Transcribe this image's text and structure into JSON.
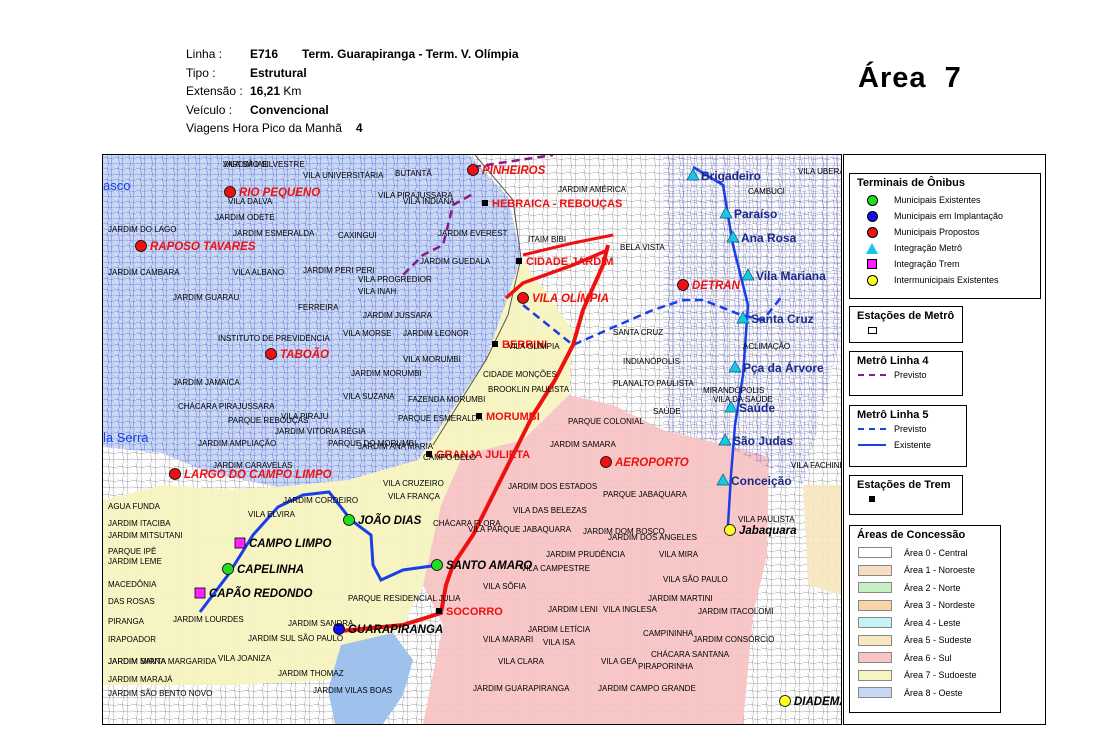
{
  "route_info": {
    "line_label": "Linha :",
    "line_code": "E716",
    "line_name": "Term. Guarapiranga - Term. V. Olímpia",
    "type_label": "Tipo :",
    "type_value": "Estrutural",
    "length_label": "Extensão :",
    "length_value": "16,21",
    "length_unit": "Km",
    "vehicle_label": "Veículo :",
    "vehicle_value": "Convencional",
    "trips_label": "Viagens Hora Pico da Manhã",
    "trips_value": "4"
  },
  "area_title": "Área  7",
  "legend": {
    "terminals": {
      "title": "Terminais de Ônibus",
      "items": [
        {
          "label": "Municipais Existentes",
          "color": "#22dd22",
          "shape": "circle"
        },
        {
          "label": "Municipais em Implantação",
          "color": "#1010e6",
          "shape": "circle"
        },
        {
          "label": "Municipais Propostos",
          "color": "#ee1111",
          "shape": "circle"
        },
        {
          "label": "Integração Metrô",
          "color": "#19c6e8",
          "shape": "triangle"
        },
        {
          "label": "Integração Trem",
          "color": "#ff22ff",
          "shape": "square"
        },
        {
          "label": "Intermunicipais Existentes",
          "color": "#ffff22",
          "shape": "circle"
        }
      ]
    },
    "metro_stations": {
      "title": "Estações de Metrô"
    },
    "metro_line4": {
      "title": "Metrô Linha 4",
      "items": [
        {
          "label": "Previsto",
          "color": "#8a1a8a",
          "style": "dashed"
        }
      ]
    },
    "metro_line5": {
      "title": "Metrô Linha 5",
      "items": [
        {
          "label": "Previsto",
          "color": "#1a3ee8",
          "style": "dashed"
        },
        {
          "label": "Existente",
          "color": "#1a3ee8",
          "style": "solid"
        }
      ]
    },
    "train_stations": {
      "title": "Estações de Trem"
    },
    "concession": {
      "title": "Áreas de Concessão",
      "items": [
        {
          "label": "Área 0 - Central",
          "color": "#ffffff"
        },
        {
          "label": "Área 1 - Noroeste",
          "color": "#f8dcc4"
        },
        {
          "label": "Área 2 - Norte",
          "color": "#c4f0c4"
        },
        {
          "label": "Área 3 - Nordeste",
          "color": "#f8d4a8"
        },
        {
          "label": "Área 4 - Leste",
          "color": "#c4f4f4"
        },
        {
          "label": "Área 5 - Sudeste",
          "color": "#f8e8c0"
        },
        {
          "label": "Área 6 - Sul",
          "color": "#f8c4c4"
        },
        {
          "label": "Área 7 - Sudoeste",
          "color": "#f8f4c0"
        },
        {
          "label": "Área 8 - Oeste",
          "color": "#c8d8f4"
        }
      ]
    }
  },
  "map": {
    "terminals": [
      {
        "name": "PINHEIROS",
        "kind": "proposed"
      },
      {
        "name": "RIO PEQUENO",
        "kind": "proposed"
      },
      {
        "name": "RAPOSO TAVARES",
        "kind": "proposed"
      },
      {
        "name": "VILA OLÍMPIA",
        "kind": "proposed"
      },
      {
        "name": "DETRAN",
        "kind": "proposed"
      },
      {
        "name": "TABOÃO",
        "kind": "proposed"
      },
      {
        "name": "AEROPORTO",
        "kind": "proposed"
      },
      {
        "name": "LARGO DO CAMPO LIMPO",
        "kind": "proposed"
      },
      {
        "name": "JOÃO DIAS",
        "kind": "existing"
      },
      {
        "name": "CAPELINHA",
        "kind": "existing"
      },
      {
        "name": "SANTO AMARO",
        "kind": "existing"
      },
      {
        "name": "GUARAPIRANGA",
        "kind": "implementation"
      },
      {
        "name": "CAMPO LIMPO",
        "kind": "train"
      },
      {
        "name": "CAPÃO REDONDO",
        "kind": "train"
      },
      {
        "name": "Jabaquara",
        "kind": "intermunicipal"
      },
      {
        "name": "DIADEMA",
        "kind": "intermunicipal"
      }
    ],
    "metro_stations": [
      "Brigadeiro",
      "Paraíso",
      "Ana Rosa",
      "Vila Mariana",
      "Santa Cruz",
      "Pça da Árvore",
      "Saúde",
      "São Judas",
      "Conceição"
    ],
    "train_stations": [
      "HEBRAICA - REBOUÇAS",
      "CIDADE JARDIM",
      "BERRINI",
      "MORUMBI",
      "GRANJA JULIETA",
      "SOCORRO"
    ],
    "edge_labels": [
      "asco",
      "la Serra"
    ],
    "neighborhoods": [
      "VILA SÃO SILVESTRE",
      "VILA UNIVERSITÁRIA",
      "BUTANTÃ",
      "JARDIM AMÉRICA",
      "VILA INDIANA",
      "VILA DALVA",
      "VILA PIRAJUSSARA",
      "JARDIM ODETE",
      "JARDIM ESMERALDA",
      "JARDIM DO LAGO",
      "JARDIM EVEREST",
      "CAXINGUI",
      "JARDIM GUEDALA",
      "ITAIM BIBI",
      "BELA VISTA",
      "JARDIM CAMBARA",
      "VILA ALBANO",
      "JARDIM PERI PERI",
      "VILA PROGREDIOR",
      "VILA INAH",
      "JARDIM GUARAU",
      "FERREIRA",
      "JARDIM JUSSARA",
      "VILA MORSE",
      "JARDIM LEONOR",
      "INSTITUTO DE PREVIDÊNCIA",
      "VILA OLÍMPIA",
      "VILA MORUMBI",
      "JARDIM MORUMBI",
      "CIDADE MONÇÕES",
      "BROOKLIN PAULISTA",
      "JARDIM JAMAICA",
      "VILA SUZANA",
      "FAZENDA MORUMBI",
      "CHÁCARA PIRAJUSSARA",
      "VILA PIRAJU",
      "PARQUE ESMERALDA",
      "PARQUE REBOUÇAS",
      "JARDIM VITÓRIA RÉGIA",
      "JARDIM ANA MARIA",
      "JARDIM AMPLIAÇÃO",
      "PARQUE DO MORUMBI",
      "CAMPO BELO",
      "PARQUE COLONIAL",
      "JARDIM SAMARA",
      "JARDIM CARAVELAS",
      "VILA CRUZEIRO",
      "VILA FRANÇA",
      "JARDIM CORDEIRO",
      "JARDIM DOS ESTADOS",
      "PARQUE JABAQUARA",
      "VILA DAS BELEZAS",
      "VILA ELVIRA",
      "CHÁCARA FLORA",
      "VILA PARQUE JABAQUARA",
      "JARDIM DOM BOSCO",
      "JARDIM DOS ANGELES",
      "JARDIM PRUDÊNCIA",
      "VILA MIRA",
      "VILA SÃO PAULO",
      "VILA CAMPESTRE",
      "VILA SÔFIA",
      "PARQUE RESIDENCIAL JULIA",
      "JARDIM LENI",
      "VILA INGLESA",
      "JARDIM ITACOLOMI",
      "JARDIM LOURDES",
      "JARDIM SANDRA",
      "JARDIM LETÍCIA",
      "CAMPININHA",
      "VILA MARARI",
      "VILA ISA",
      "JARDIM CONSÓRCIO",
      "JARDIM SUL SÃO PAULO",
      "CHÁCARA SANTANA",
      "VILA CLARA",
      "VILA GEA",
      "VILA JOANIZA",
      "JARDIM THOMAZ",
      "PIRAPORINHA",
      "JARDIM VILAS BOAS",
      "JARDIM GUARAPIRANGA",
      "JARDIM CAMPO GRANDE",
      "JARDIM MARTINI",
      "SANTA CRUZ",
      "PLANALTO PAULISTA",
      "INDIANÓPOLIS",
      "VILA UBERABINHA",
      "CAMBUCI",
      "ACLIMAÇÃO",
      "MIRANDÓPOLIS",
      "VILA DA SAÚDE",
      "SAÚDE",
      "VILA PAULISTA",
      "VILA FACHINI",
      "AGUA FUNDA",
      "JARDIM ITACIBA",
      "JARDIM MITSUTANI",
      "PARQUE IPÊ",
      "JARDIM LEME",
      "MACEDÔNIA",
      "DAS ROSAS",
      "PIRANGA",
      "IRAPOADOR",
      "JARDIM MIRNA",
      "JARDIM MARAJÁ",
      "JARDIM SÃO BENTO NOVO",
      "JARDIM SANTA MARGARIDA",
      "JARDIM IAE"
    ]
  }
}
